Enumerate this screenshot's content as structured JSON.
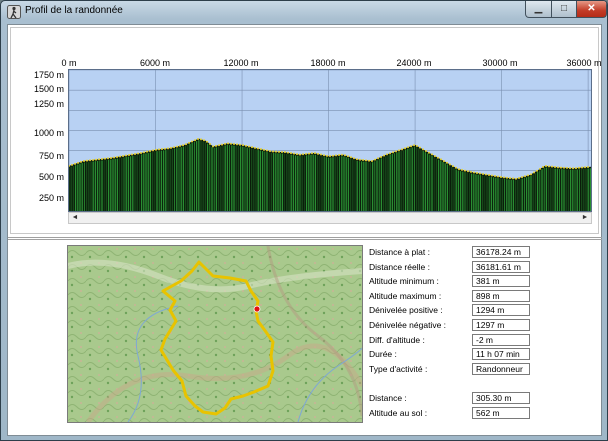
{
  "window": {
    "title": "Profil de la randonnée",
    "icon": "hiker-app-icon",
    "minimize_glyph": "▁",
    "maximize_glyph": "□",
    "close_glyph": "✕"
  },
  "profile": {
    "x_ticks": [
      "0 m",
      "6000 m",
      "12000 m",
      "18000 m",
      "24000 m",
      "30000 m",
      "36000 m"
    ],
    "y_ticks": [
      "1750 m",
      "1500 m",
      "1250 m",
      "1000 m",
      "750 m",
      "500 m",
      "250 m"
    ],
    "scroll_left_glyph": "◄",
    "scroll_right_glyph": "►"
  },
  "chart_data": {
    "type": "area",
    "x": [
      0,
      1000,
      2000,
      3000,
      4000,
      5000,
      6000,
      7000,
      8000,
      8500,
      9000,
      9500,
      10000,
      11000,
      12000,
      13000,
      14000,
      15000,
      16000,
      17000,
      18000,
      19000,
      20000,
      21000,
      22000,
      23000,
      24000,
      25000,
      26000,
      27000,
      28000,
      29000,
      30000,
      31000,
      32000,
      33000,
      34000,
      35000,
      36200
    ],
    "y": [
      560,
      620,
      640,
      660,
      690,
      720,
      760,
      780,
      820,
      860,
      898,
      870,
      800,
      840,
      820,
      780,
      740,
      730,
      700,
      720,
      680,
      700,
      640,
      620,
      700,
      760,
      820,
      720,
      620,
      520,
      480,
      450,
      420,
      400,
      450,
      560,
      540,
      530,
      550
    ],
    "xlim": [
      0,
      36200
    ],
    "ylim": [
      0,
      1750
    ],
    "x_tick_values": [
      0,
      6000,
      12000,
      18000,
      24000,
      30000,
      36000
    ],
    "y_tick_values": [
      1750,
      1500,
      1250,
      1000,
      750,
      500,
      250
    ],
    "grid": true,
    "colors": {
      "background": "#b8d1f3",
      "fill_dark": "#0a1a0a",
      "fill_green": "#2fa33a",
      "outline_dots": "#e8d230",
      "grid": "#7a8fb0"
    }
  },
  "map": {
    "track_color": "#e8c300",
    "marker_color": "#e01010"
  },
  "stats": [
    {
      "label": "Distance à plat :",
      "value": "36178.24 m"
    },
    {
      "label": "Distance réelle :",
      "value": "36181.61 m"
    },
    {
      "label": "Altitude minimum :",
      "value": "381 m"
    },
    {
      "label": "Altitude maximum :",
      "value": "898 m"
    },
    {
      "label": "Dénivelée positive :",
      "value": "1294 m"
    },
    {
      "label": "Dénivelée négative :",
      "value": "1297 m"
    },
    {
      "label": "Diff. d'altitude :",
      "value": "-2 m"
    },
    {
      "label": "Durée :",
      "value": "11 h 07 min"
    },
    {
      "label": "Type d'activité :",
      "value": "Randonneur"
    }
  ],
  "cursor_stats": [
    {
      "label": "Distance :",
      "value": "305.30 m"
    },
    {
      "label": "Altitude au sol :",
      "value": "562 m"
    }
  ]
}
